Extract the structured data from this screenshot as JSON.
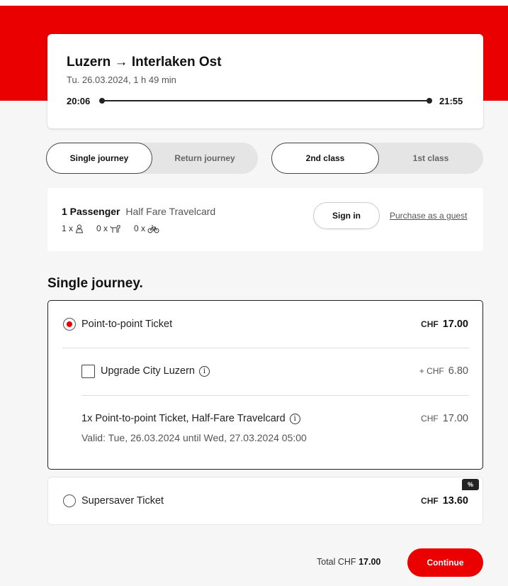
{
  "journey": {
    "title": "Luzern → Interlaken Ost",
    "subtitle": "Tu. 26.03.2024, 1 h 49 min",
    "departure": "20:06",
    "arrival": "21:55"
  },
  "journey_type": {
    "options": [
      "Single journey",
      "Return journey"
    ],
    "selected": "Single journey"
  },
  "travel_class": {
    "options": [
      "2nd class",
      "1st class"
    ],
    "selected": "2nd class"
  },
  "passenger": {
    "count_label": "1 Passenger",
    "card_label": "Half Fare Travelcard",
    "adults": "1 x",
    "dogs": "0 x",
    "bikes": "0 x",
    "sign_in": "Sign in",
    "guest": "Purchase as a guest"
  },
  "section_title": "Single journey.",
  "offers": {
    "p2p": {
      "label": "Point-to-point Ticket",
      "currency": "CHF",
      "price": "17.00"
    },
    "upgrade": {
      "label": "Upgrade City Luzern",
      "currency": "+ CHF",
      "price": "6.80"
    },
    "detail": {
      "label": "1x Point-to-point Ticket, Half-Fare Travelcard",
      "currency": "CHF",
      "price": "17.00",
      "valid": "Valid: Tue, 26.03.2024 until Wed, 27.03.2024 05:00"
    },
    "supersaver": {
      "label": "Supersaver Ticket",
      "currency": "CHF",
      "price": "13.60",
      "badge": "%"
    }
  },
  "footer": {
    "total_label": "Total CHF",
    "total_value": "17.00",
    "continue": "Continue"
  },
  "colors": {
    "brand": "#eb0000"
  }
}
